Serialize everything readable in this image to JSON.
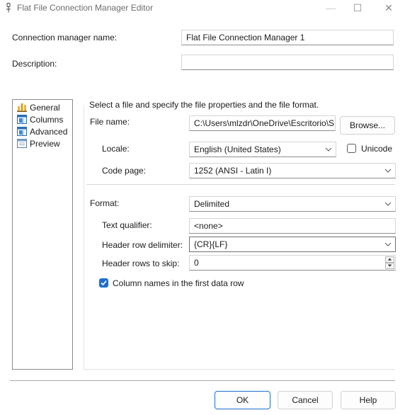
{
  "window": {
    "title": "Flat File Connection Manager Editor",
    "minimize_glyph": "—",
    "maximize_glyph": "☐",
    "close_glyph": "✕"
  },
  "header": {
    "connection_name_label": "Connection manager name:",
    "connection_name_value": "Flat File Connection Manager 1",
    "description_label": "Description:",
    "description_value": ""
  },
  "nav": {
    "items": [
      {
        "label": "General",
        "icon": "general-icon",
        "selected": true
      },
      {
        "label": "Columns",
        "icon": "columns-icon",
        "selected": false
      },
      {
        "label": "Advanced",
        "icon": "advanced-icon",
        "selected": false
      },
      {
        "label": "Preview",
        "icon": "preview-icon",
        "selected": false
      }
    ]
  },
  "general": {
    "group_title": "Select a file and specify the file properties and the file format.",
    "file_name_label": "File name:",
    "file_name_value": "C:\\Users\\mlzdr\\OneDrive\\Escritorio\\S",
    "browse_label": "Browse...",
    "locale_label": "Locale:",
    "locale_value": "English (United States)",
    "unicode_label": "Unicode",
    "unicode_checked": false,
    "code_page_label": "Code page:",
    "code_page_value": "1252  (ANSI - Latin I)",
    "format_label": "Format:",
    "format_value": "Delimited",
    "text_qualifier_label": "Text qualifier:",
    "text_qualifier_value": "<none>",
    "header_delim_label": "Header row delimiter:",
    "header_delim_value": "{CR}{LF}",
    "header_skip_label": "Header rows to skip:",
    "header_skip_value": "0",
    "column_names_label": "Column names in the first data row",
    "column_names_checked": true
  },
  "footer": {
    "ok_label": "OK",
    "cancel_label": "Cancel",
    "help_label": "Help"
  },
  "colors": {
    "accent": "#1e6fcc",
    "border": "#d5d5d5"
  }
}
